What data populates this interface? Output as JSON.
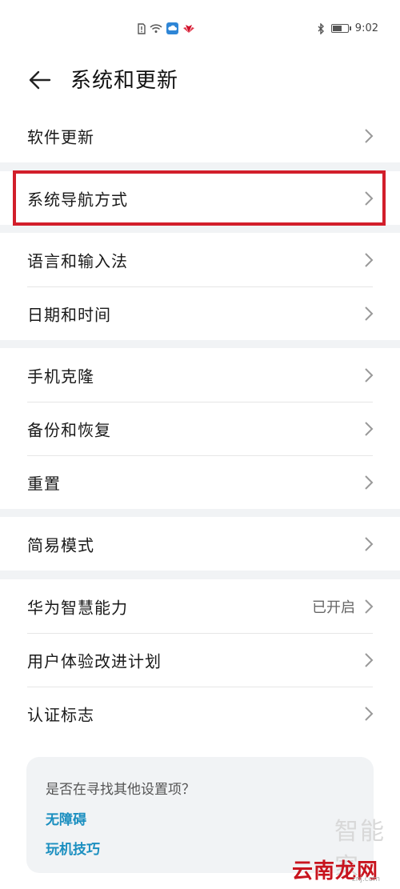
{
  "status_bar": {
    "time": "9:02",
    "icons": [
      "sim-alert-icon",
      "wifi-icon",
      "cloud-icon",
      "huawei-logo-icon",
      "bluetooth-icon",
      "battery-icon"
    ],
    "battery_level": 0.6
  },
  "header": {
    "title": "系统和更新",
    "back_icon": "arrow-left-icon"
  },
  "groups": [
    {
      "items": [
        {
          "label": "软件更新"
        }
      ]
    },
    {
      "items": [
        {
          "label": "系统导航方式",
          "highlighted": true
        }
      ]
    },
    {
      "items": [
        {
          "label": "语言和输入法"
        },
        {
          "label": "日期和时间"
        }
      ]
    },
    {
      "items": [
        {
          "label": "手机克隆"
        },
        {
          "label": "备份和恢复"
        },
        {
          "label": "重置"
        }
      ]
    },
    {
      "items": [
        {
          "label": "简易模式"
        }
      ]
    },
    {
      "items": [
        {
          "label": "华为智慧能力",
          "value": "已开启"
        },
        {
          "label": "用户体验改进计划"
        },
        {
          "label": "认证标志"
        }
      ]
    }
  ],
  "suggestions": {
    "question": "是否在寻找其他设置项？",
    "links": [
      "无障碍",
      "玩机技巧"
    ]
  },
  "watermark": {
    "brand": "智能家",
    "logo": "云南龙网",
    "sub": "znj.com"
  },
  "colors": {
    "highlight": "#d21e2b",
    "link": "#1b8fc0",
    "background": "#f1f3f5"
  }
}
